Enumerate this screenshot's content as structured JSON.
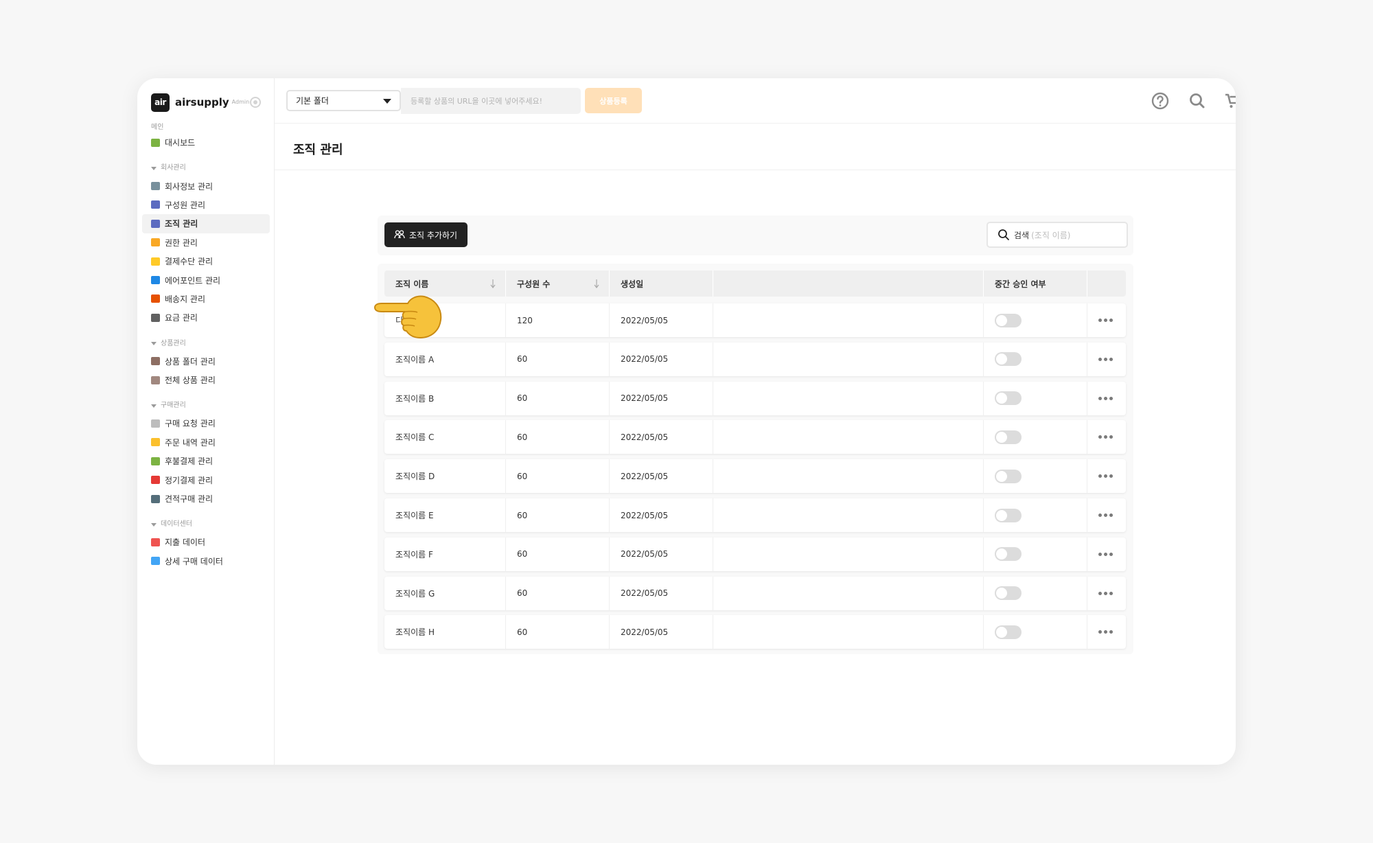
{
  "brand": {
    "logo_text": "air",
    "name": "airsupply",
    "sub": "Admin"
  },
  "sidebar": {
    "main_label": "메인",
    "dashboard": "대시보드",
    "groups": [
      {
        "title": "회사관리",
        "items": [
          "회사정보 관리",
          "구성원 관리",
          "조직 관리",
          "권한 관리",
          "결제수단 관리",
          "에어포인트 관리",
          "배송지 관리",
          "요금 관리"
        ]
      },
      {
        "title": "상품관리",
        "items": [
          "상품 폴더 관리",
          "전체 상품 관리"
        ]
      },
      {
        "title": "구매관리",
        "items": [
          "구매 요청 관리",
          "주문 내역 관리",
          "후불결제 관리",
          "정기결제 관리",
          "견적구매 관리"
        ]
      },
      {
        "title": "데이터센터",
        "items": [
          "지출 데이터",
          "상세 구매 데이터"
        ]
      }
    ],
    "active_item": "조직 관리"
  },
  "header": {
    "folder_select": "기본 폴더",
    "url_placeholder": "등록할 상품의 URL을 이곳에 넣어주세요!",
    "register_label": "상품등록"
  },
  "page": {
    "title": "조직 관리",
    "add_button": "조직 추가하기",
    "search_label": "검색",
    "search_placeholder": "(조직 이름)"
  },
  "table": {
    "columns": [
      "조직 이름",
      "구성원 수",
      "생성일",
      "",
      "중간 승인 여부",
      ""
    ],
    "rows": [
      {
        "name": "디자인팀",
        "members": "120",
        "created": "2022/05/05",
        "approval": false
      },
      {
        "name": "조직이름 A",
        "members": "60",
        "created": "2022/05/05",
        "approval": false
      },
      {
        "name": "조직이름 B",
        "members": "60",
        "created": "2022/05/05",
        "approval": false
      },
      {
        "name": "조직이름 C",
        "members": "60",
        "created": "2022/05/05",
        "approval": false
      },
      {
        "name": "조직이름 D",
        "members": "60",
        "created": "2022/05/05",
        "approval": false
      },
      {
        "name": "조직이름 E",
        "members": "60",
        "created": "2022/05/05",
        "approval": false
      },
      {
        "name": "조직이름 F",
        "members": "60",
        "created": "2022/05/05",
        "approval": false
      },
      {
        "name": "조직이름 G",
        "members": "60",
        "created": "2022/05/05",
        "approval": false
      },
      {
        "name": "조직이름 H",
        "members": "60",
        "created": "2022/05/05",
        "approval": false
      }
    ]
  },
  "colors": {
    "accent_dark": "#222222",
    "register_button": "#ffe0b8",
    "notification_dot": "#e53935",
    "toggle_off": "#dcdcdc"
  }
}
